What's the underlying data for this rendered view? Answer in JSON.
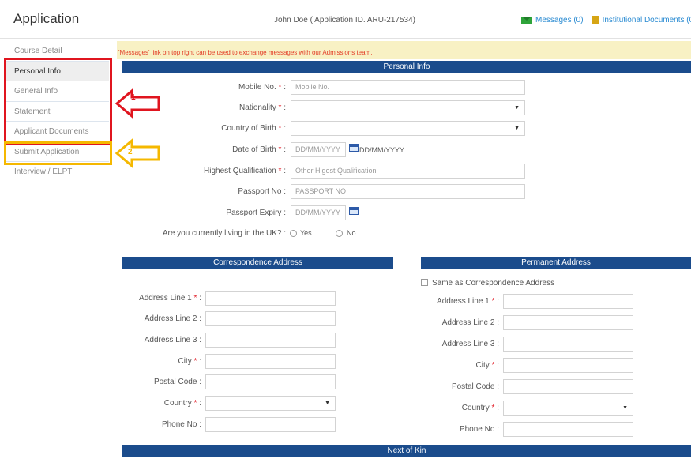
{
  "header": {
    "title": "Application",
    "user_info": "John Doe ( Application ID. ARU-217534)",
    "messages_link": "Messages (0)",
    "documents_link": "Institutional Documents (0"
  },
  "sidebar": {
    "items": [
      {
        "label": "Course Detail"
      },
      {
        "label": "Personal Info"
      },
      {
        "label": "General Info"
      },
      {
        "label": "Statement"
      },
      {
        "label": "Applicant Documents"
      },
      {
        "label": "Submit Application"
      },
      {
        "label": "Interview / ELPT"
      }
    ]
  },
  "annotations": {
    "callout_1": "1",
    "callout_2": "2",
    "red": "#e0151f",
    "yellow": "#f5b800"
  },
  "notice": "'Messages' link on top right can be used to exchange messages with our Admissions team.",
  "personal": {
    "section_title": "Personal Info",
    "mobile_label": "Mobile No.",
    "mobile_placeholder": "Mobile No.",
    "nationality_label": "Nationality",
    "country_birth_label": "Country of Birth",
    "dob_label": "Date of Birth",
    "dob_placeholder": "DD/MM/YYYY",
    "dob_hint": "DD/MM/YYYY",
    "qualification_label": "Highest Qualification",
    "qualification_placeholder": "Other Higest Qualification",
    "passport_label": "Passport No :",
    "passport_placeholder": "PASSPORT NO",
    "passport_expiry_label": "Passport Expiry :",
    "passport_expiry_placeholder": "DD/MM/YYYY",
    "uk_question": "Are you currently living in the UK? :",
    "yes": "Yes",
    "no": "No"
  },
  "correspondence": {
    "title": "Correspondence Address",
    "line1": "Address Line 1",
    "line2": "Address Line 2 :",
    "line3": "Address Line 3 :",
    "city": "City",
    "postal": "Postal Code :",
    "country": "Country",
    "phone": "Phone No :"
  },
  "permanent": {
    "title": "Permanent Address",
    "same_as": "Same as Correspondence Address",
    "line1": "Address Line 1",
    "line2": "Address Line 2 :",
    "line3": "Address Line 3 :",
    "city": "City",
    "postal": "Postal Code :",
    "country": "Country",
    "phone": "Phone No :"
  },
  "next_of_kin": {
    "title": "Next of Kin"
  },
  "colors": {
    "nav_blue": "#1b4c8c",
    "link_blue": "#2a8bd2",
    "required_red": "#e0151f"
  }
}
